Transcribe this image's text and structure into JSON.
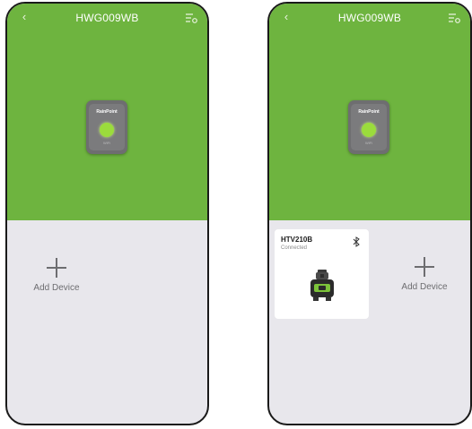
{
  "left_screen": {
    "title": "HWG009WB",
    "back_icon": "chevron-left-icon",
    "menu_icon": "list-settings-icon",
    "hub": {
      "brand": "RainPoint",
      "wifi_label": "WiFi"
    },
    "add_device": {
      "icon": "plus-icon",
      "label": "Add Device"
    }
  },
  "right_screen": {
    "title": "HWG009WB",
    "back_icon": "chevron-left-icon",
    "menu_icon": "list-settings-icon",
    "hub": {
      "brand": "RainPoint",
      "wifi_label": "WiFi"
    },
    "device": {
      "name": "HTV210B",
      "status": "Connected",
      "icon": "bluetooth-icon"
    },
    "add_device": {
      "icon": "plus-icon",
      "label": "Add Device"
    }
  },
  "colors": {
    "header_green": "#6eb43f",
    "panel_gray": "#e8e7ec",
    "hub_gray": "#6e6e70",
    "hub_light": "#9bdc3c",
    "text_gray": "#6d6d70"
  }
}
